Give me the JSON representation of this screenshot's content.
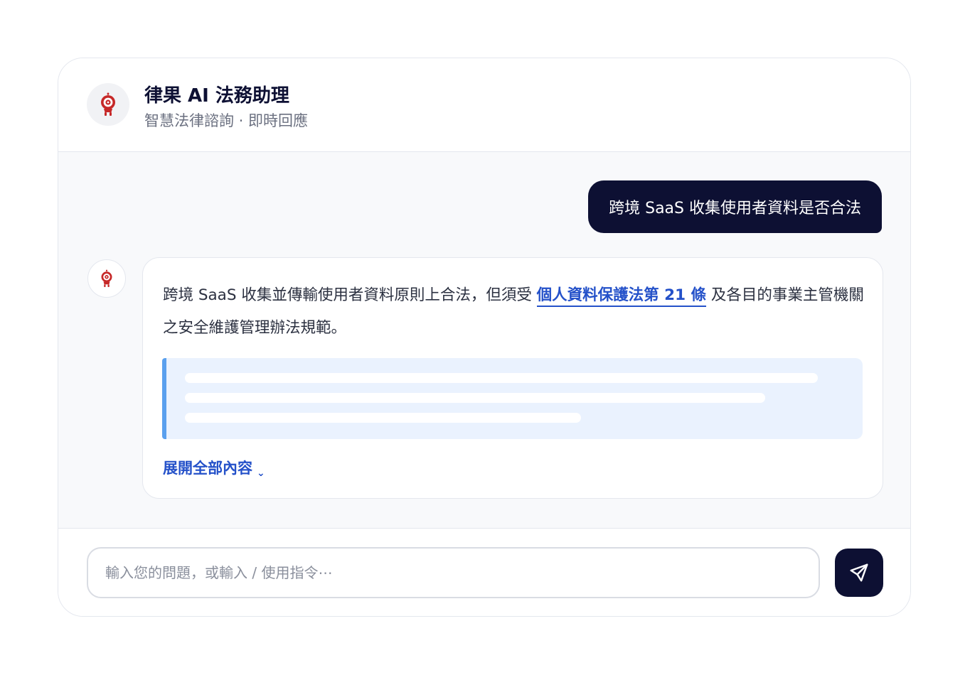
{
  "app": {
    "title": "律果 AI 法務助理",
    "subtitle": "智慧法律諮詢 · 即時回應",
    "logo_icon": "robot-mascot-icon"
  },
  "conversation": {
    "user_message": "跨境 SaaS 收集使用者資料是否合法",
    "assistant": {
      "avatar_icon": "robot-mascot-icon",
      "text_before": "跨境 SaaS 收集並傳輸使用者資料原則上合法，但須受 ",
      "link_text": "個人資料保護法第 21 條",
      "text_after": " 及各目的事業主管機關之安全維護管理辦法規範。",
      "quote_loading": true,
      "expand_label": "展開全部內容",
      "expand_icon": "chevron-down-icon"
    }
  },
  "composer": {
    "placeholder": "輸入您的問題，或輸入 / 使用指令⋯",
    "value": "",
    "send_icon": "send-icon"
  },
  "colors": {
    "primary_dark": "#0d1033",
    "link": "#2451c9",
    "brand_red": "#c62828",
    "quote_bg": "#eaf2fe",
    "quote_border": "#5aa0ee",
    "chat_bg": "#f8f9fb"
  }
}
